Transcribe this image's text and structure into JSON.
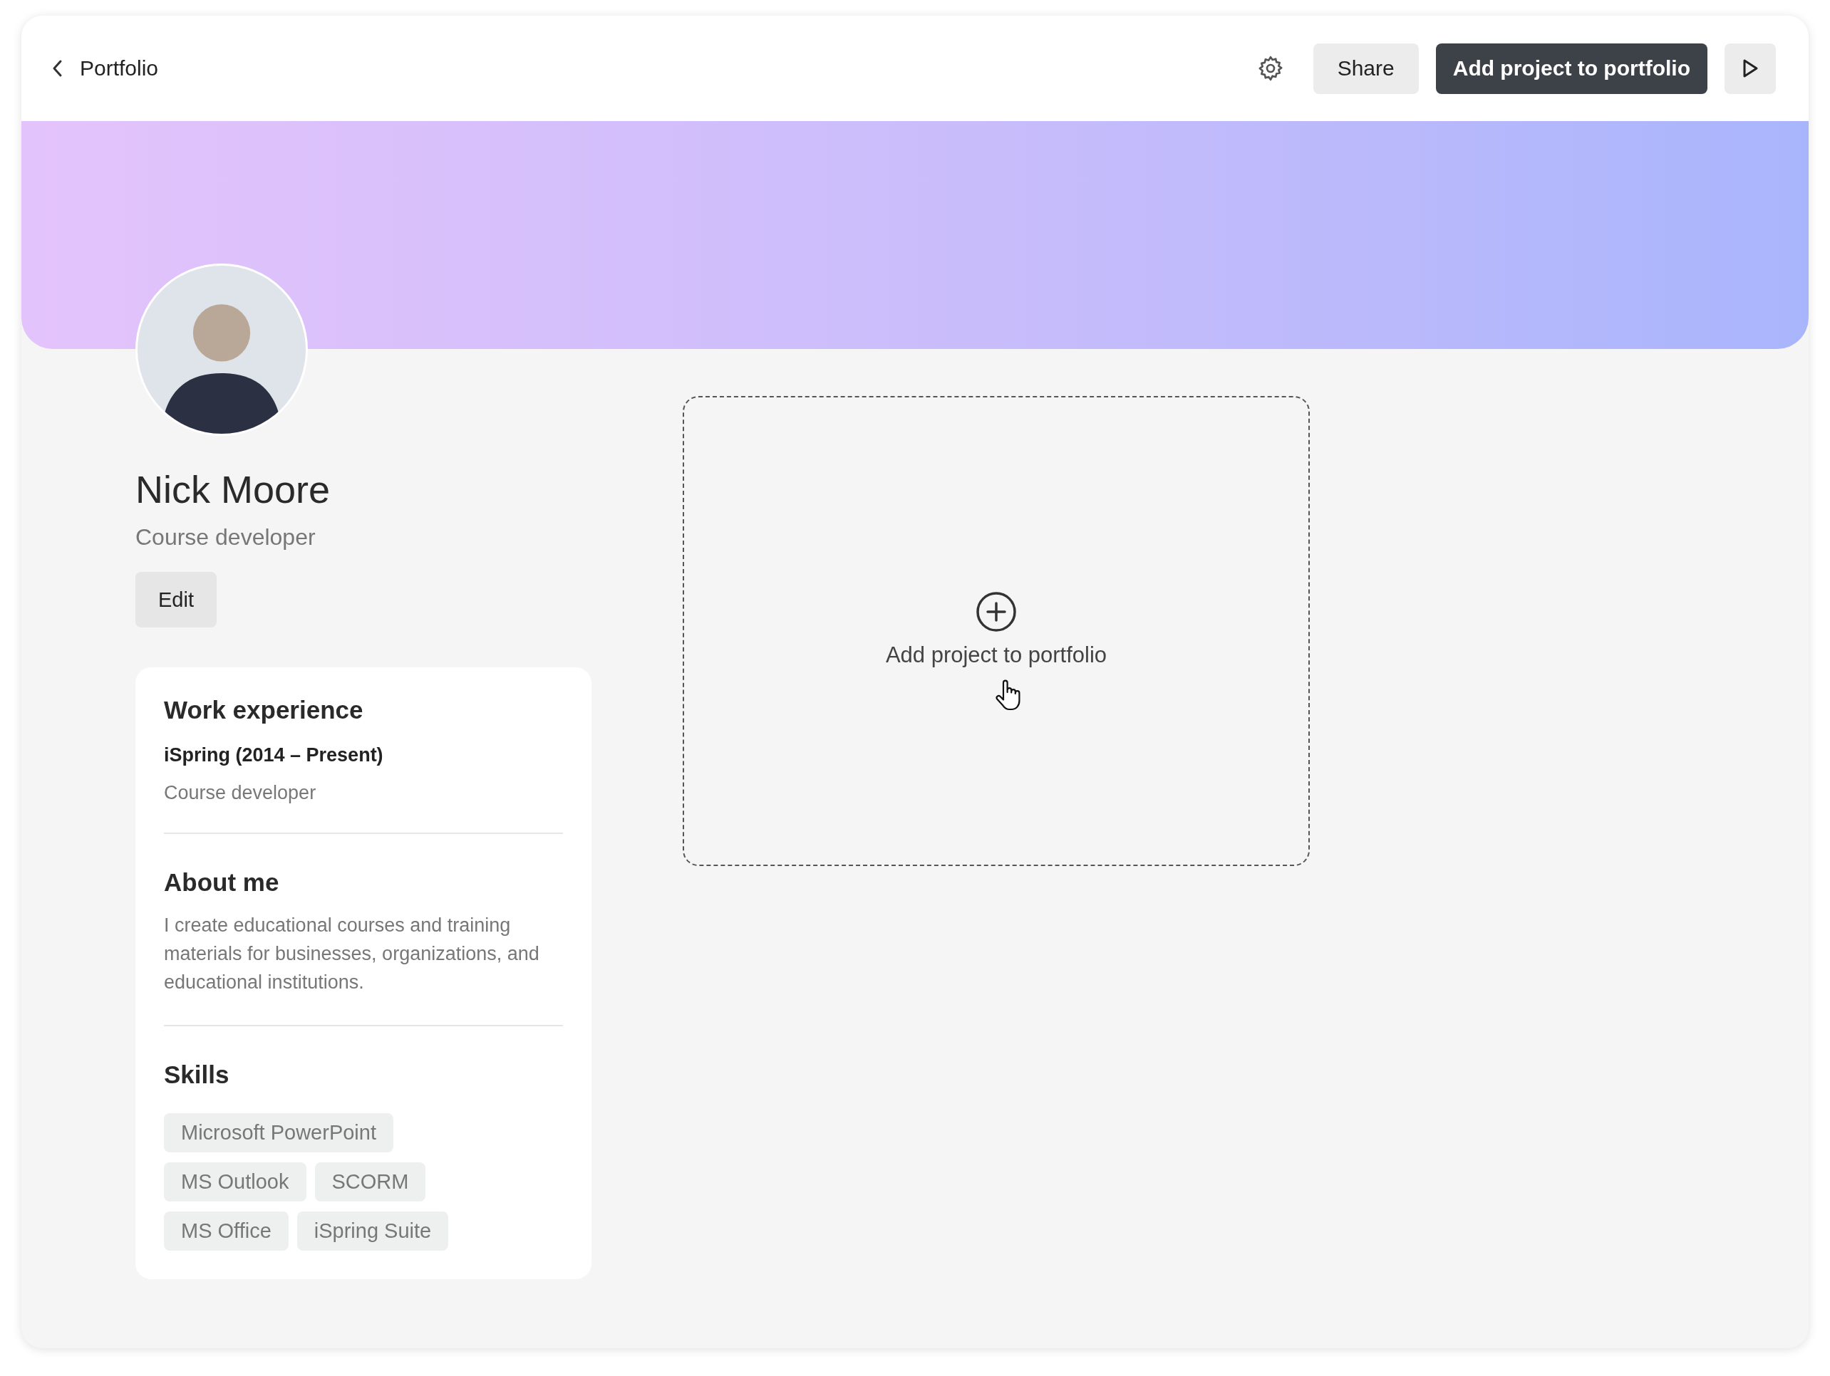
{
  "header": {
    "back_label": "Portfolio",
    "share": "Share",
    "add_project": "Add project to portfolio"
  },
  "profile": {
    "name": "Nick Moore",
    "title": "Course developer",
    "edit": "Edit"
  },
  "work_experience": {
    "heading": "Work experience",
    "company": "iSpring (2014 – Present)",
    "role": "Course developer"
  },
  "about": {
    "heading": "About me",
    "text": "I create educational courses and training materials for businesses, organizations, and educational institutions."
  },
  "skills": {
    "heading": "Skills",
    "rows": [
      [
        "Microsoft PowerPoint"
      ],
      [
        "MS Outlook",
        "SCORM"
      ],
      [
        "MS Office",
        "iSpring Suite"
      ]
    ]
  },
  "dropzone": {
    "label": "Add project to portfolio"
  }
}
